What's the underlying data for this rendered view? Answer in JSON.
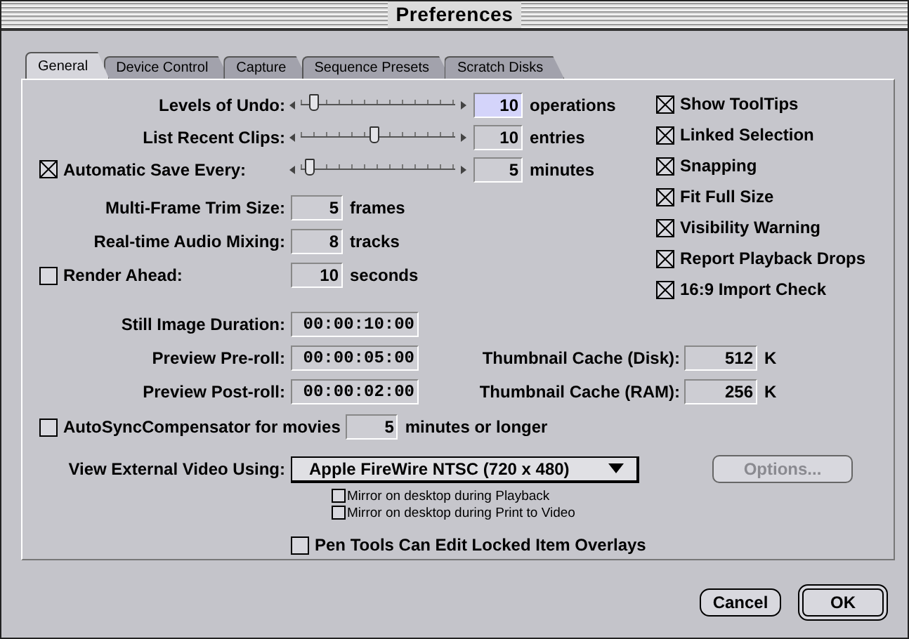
{
  "window": {
    "title": "Preferences"
  },
  "tabs": [
    {
      "label": "General",
      "selected": true
    },
    {
      "label": "Device Control",
      "selected": false
    },
    {
      "label": "Capture",
      "selected": false
    },
    {
      "label": "Sequence Presets",
      "selected": false
    },
    {
      "label": "Scratch Disks",
      "selected": false
    }
  ],
  "slider_rows": [
    {
      "kind": "label",
      "label": "Levels of Undo:",
      "level": 0.08,
      "value": "10",
      "unit": "operations",
      "focused": true
    },
    {
      "kind": "label",
      "label": "List Recent Clips:",
      "level": 0.47,
      "value": "10",
      "unit": "entries",
      "focused": false
    },
    {
      "kind": "checkbox",
      "label": "Automatic Save Every:",
      "checked": true,
      "level": 0.05,
      "value": "5",
      "unit": "minutes",
      "focused": false
    }
  ],
  "field_rows": [
    {
      "kind": "label",
      "label": "Multi-Frame Trim Size:",
      "value": "5",
      "unit": "frames"
    },
    {
      "kind": "label",
      "label": "Real-time Audio Mixing:",
      "value": "8",
      "unit": "tracks"
    },
    {
      "kind": "checkbox",
      "label": "Render Ahead:",
      "checked": false,
      "value": "10",
      "unit": "seconds"
    }
  ],
  "options": [
    {
      "label": "Show ToolTips",
      "checked": true
    },
    {
      "label": "Linked Selection",
      "checked": true
    },
    {
      "label": "Snapping",
      "checked": true
    },
    {
      "label": "Fit Full Size",
      "checked": true
    },
    {
      "label": "Visibility Warning",
      "checked": true
    },
    {
      "label": "Report Playback Drops",
      "checked": true
    },
    {
      "label": "16:9 Import Check",
      "checked": true
    }
  ],
  "timecode_rows": [
    {
      "label": "Still Image Duration:",
      "value": "00:00:10:00"
    },
    {
      "label": "Preview Pre-roll:",
      "value": "00:00:05:00",
      "cache": {
        "label": "Thumbnail Cache (Disk):",
        "value": "512",
        "unit": "K"
      }
    },
    {
      "label": "Preview Post-roll:",
      "value": "00:00:02:00",
      "cache": {
        "label": "Thumbnail Cache (RAM):",
        "value": "256",
        "unit": "K"
      }
    }
  ],
  "autosync": {
    "label": "AutoSyncCompensator for movies",
    "checked": false,
    "value": "5",
    "unit": "minutes or longer"
  },
  "external_video": {
    "label": "View External Video Using:",
    "value": "Apple FireWire NTSC (720 x 480)",
    "options_button": {
      "label": "Options...",
      "disabled": true
    },
    "mirrors": [
      {
        "label": "Mirror on desktop during Playback",
        "checked": false
      },
      {
        "label": "Mirror on desktop during Print to Video",
        "checked": false
      }
    ]
  },
  "pen_tools": {
    "label": "Pen Tools Can Edit Locked Item Overlays",
    "checked": false
  },
  "buttons": [
    {
      "label": "Cancel",
      "default": false
    },
    {
      "label": "OK",
      "default": true
    }
  ]
}
